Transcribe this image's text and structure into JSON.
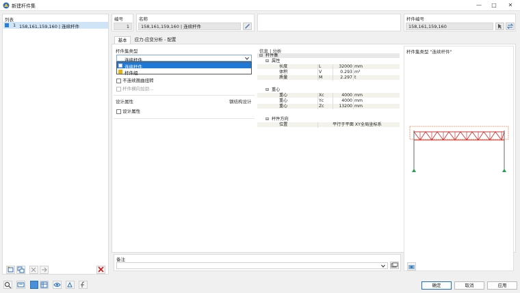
{
  "window": {
    "title": "新建杆件集",
    "controls": [
      "—",
      "□",
      "✕"
    ]
  },
  "list": {
    "header": "列表",
    "items": [
      {
        "num": "1",
        "label": "158,161,159,160 | 连续杆件",
        "color": "#2a7fd4"
      }
    ]
  },
  "top": {
    "no_label": "编号",
    "no_value": "1",
    "name_label": "名称",
    "name_value": "158,161,159,160 | 连续杆件",
    "members_label": "杆件编号",
    "members_value": "158,161,159,160"
  },
  "tabs": [
    "基本",
    "应力-应变分析 - 配置"
  ],
  "type_section": {
    "header": "杆件集类型",
    "selected": "连续杆件",
    "options": [
      {
        "label": "连续杆件",
        "color": "#2a7fd4"
      },
      {
        "label": "杆件组",
        "color": "#e3b413"
      }
    ],
    "chk_discontinuous": "不连续翘曲扭转",
    "chk_lateral": "杆件横向加劲..."
  },
  "design_section": {
    "header": "设计属性",
    "link": "钢结构设计",
    "chk_design": "设计属性"
  },
  "info": {
    "header": "信息 | 分析",
    "member_set": "杆件集",
    "props_group": "属性",
    "props": [
      {
        "name": "长度",
        "sym": "L",
        "val": "32000",
        "unit": "mm"
      },
      {
        "name": "体积",
        "sym": "V",
        "val": "0.293",
        "unit": "m³"
      },
      {
        "name": "质量",
        "sym": "M",
        "val": "2.297",
        "unit": "t"
      }
    ],
    "centroid_group": "重心",
    "centroid": [
      {
        "name": "重心",
        "sym": "Xc",
        "val": "4000",
        "unit": "mm"
      },
      {
        "name": "重心",
        "sym": "Yc",
        "val": "4000",
        "unit": "mm"
      },
      {
        "name": "重心",
        "sym": "Zc",
        "val": "13200",
        "unit": "mm"
      }
    ],
    "direction_group": "杆件方向",
    "dir_name": "位置",
    "dir_value": "平行于平面 XY全局坐标系"
  },
  "preview": {
    "title": "杆件集类型 \"连续杆件\""
  },
  "notes": {
    "header": "备注"
  },
  "footer": {
    "ok": "确定",
    "cancel": "取消",
    "apply": "应用"
  },
  "colors": {
    "accent": "#2a7fd4",
    "truss": "#d0302f",
    "support": "#23a14a"
  }
}
